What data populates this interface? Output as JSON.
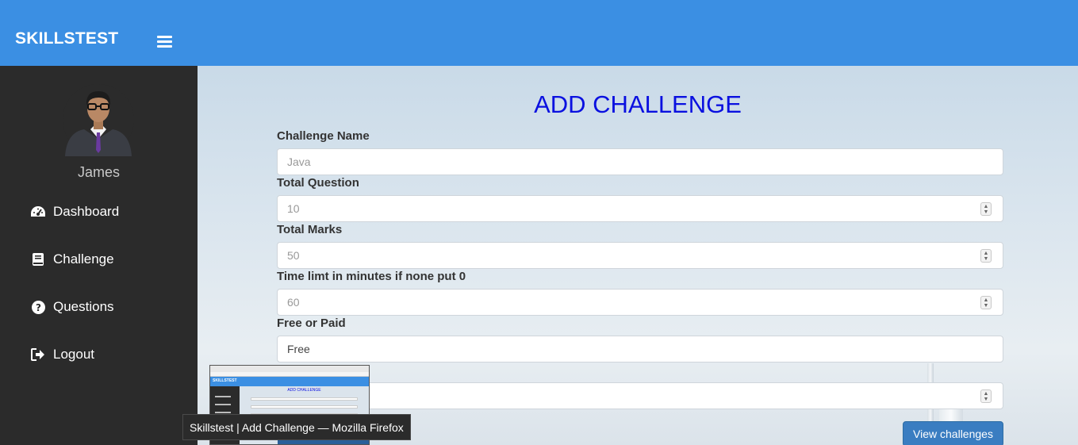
{
  "app": {
    "brand": "SKILLSTEST"
  },
  "sidebar": {
    "username": "James",
    "items": [
      {
        "label": "Dashboard",
        "icon": "dashboard-icon"
      },
      {
        "label": "Challenge",
        "icon": "book-icon"
      },
      {
        "label": "Questions",
        "icon": "question-circle-icon"
      },
      {
        "label": "Logout",
        "icon": "logout-icon"
      }
    ]
  },
  "main": {
    "title": "ADD CHALLENGE",
    "fields": [
      {
        "label": "Challenge Name",
        "placeholder": "Java"
      },
      {
        "label": "Total Question",
        "placeholder": "10"
      },
      {
        "label": "Total Marks",
        "placeholder": "50"
      },
      {
        "label": "Time limt in minutes if none put 0",
        "placeholder": "60"
      },
      {
        "label": "Free or Paid",
        "value": "Free"
      }
    ],
    "view_button": "View challenges"
  },
  "taskbar_preview": {
    "thumb_brand": "SKILLSTEST",
    "thumb_title": "ADD CHALLENGE",
    "tooltip": "Skillstest | Add Challenge — Mozilla Firefox"
  },
  "colors": {
    "topbar": "#3b8fe3",
    "sidebar": "#2b2b2b",
    "title": "#0a10e0",
    "button": "#3a7dc1"
  }
}
